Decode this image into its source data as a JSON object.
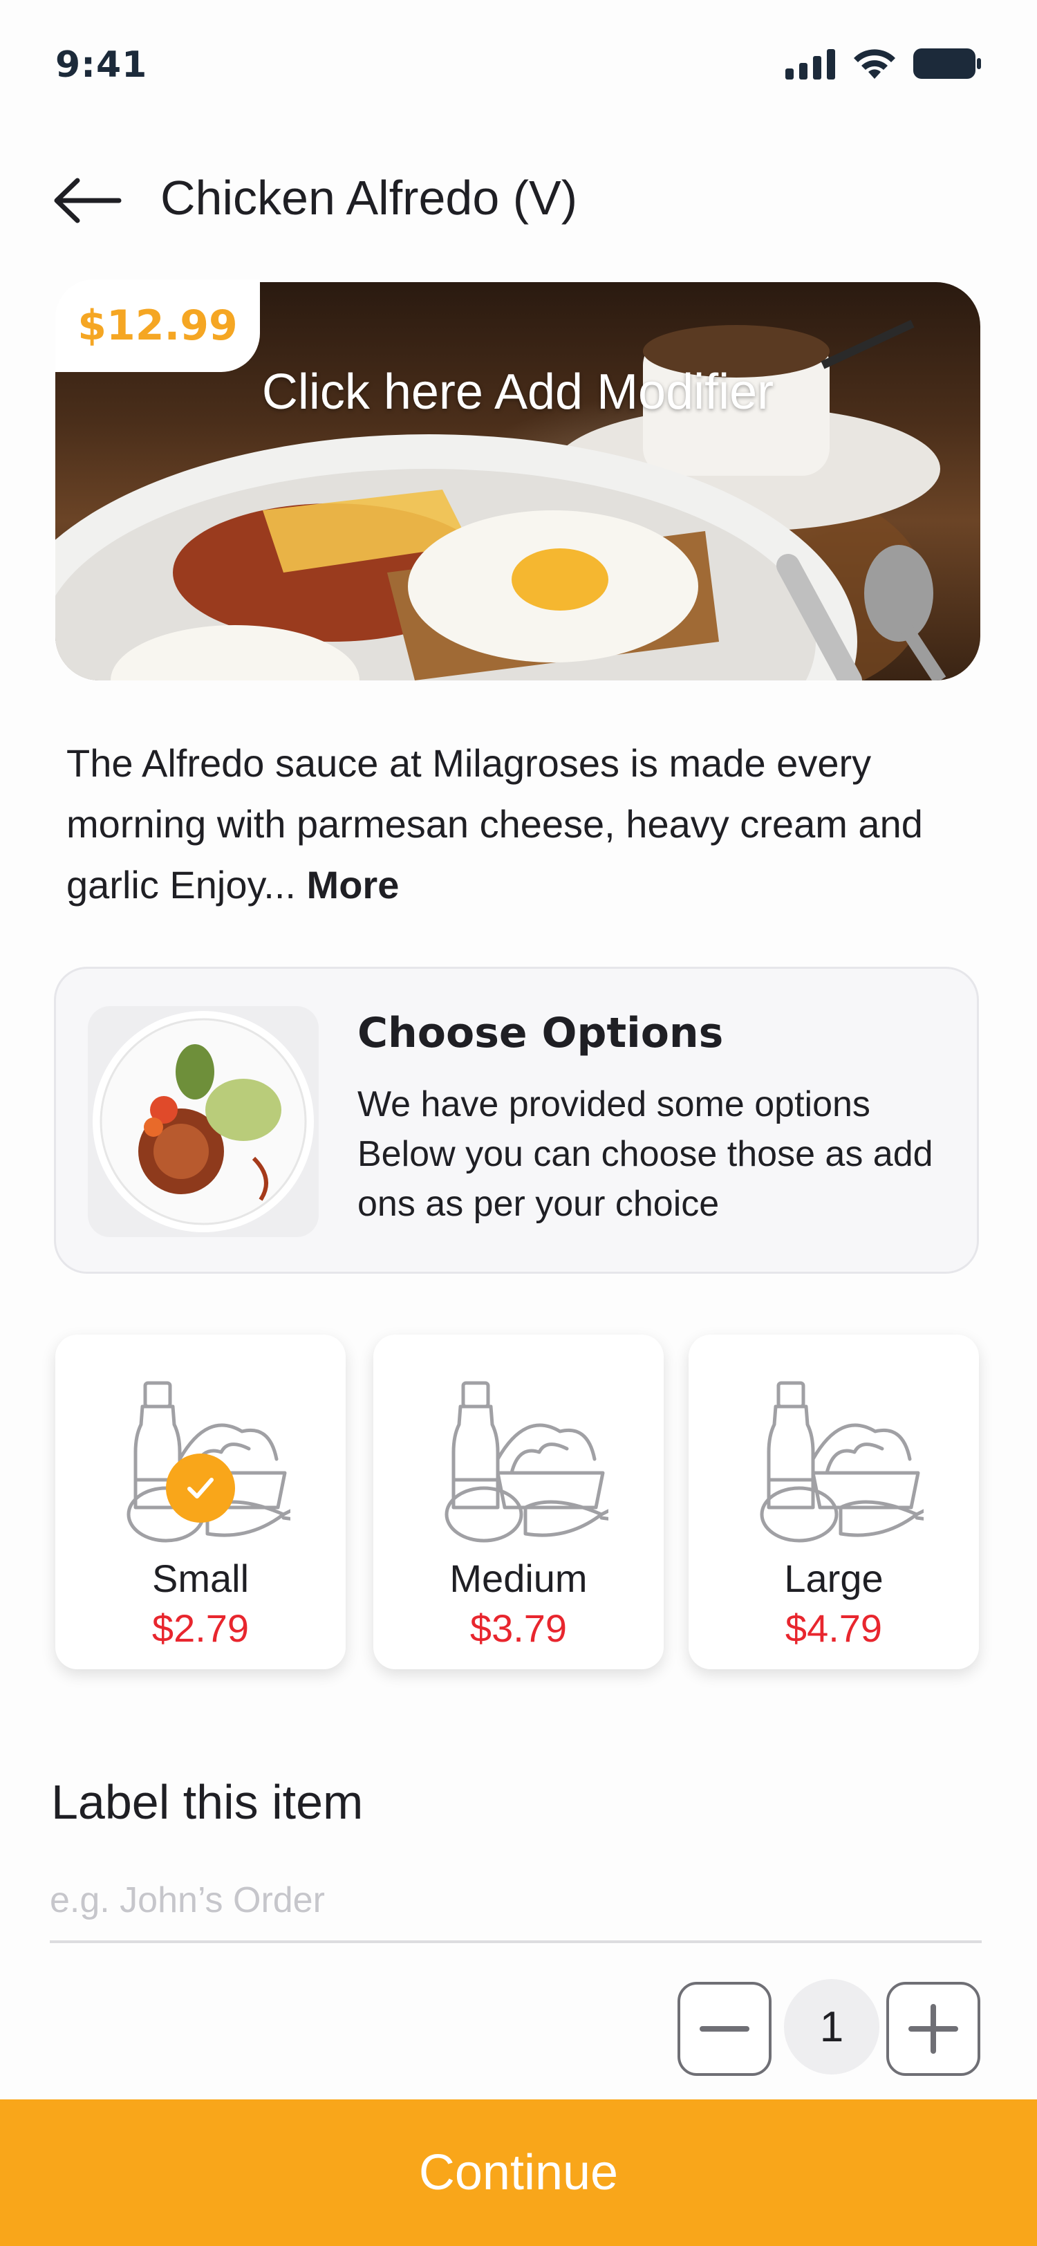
{
  "status_bar": {
    "time": "9:41"
  },
  "header": {
    "title": "Chicken Alfredo (V)"
  },
  "hero": {
    "price": "$12.99",
    "cta": "Click here Add Modifier"
  },
  "description": {
    "text": "The Alfredo sauce at Milagroses is made every morning with parmesan cheese, heavy cream and garlic Enjoy... ",
    "more_label": "More"
  },
  "options": {
    "title": "Choose Options",
    "text": "We have provided some options Below you can choose those as add ons as per your choice"
  },
  "sizes": [
    {
      "name": "Small",
      "price": "$2.79",
      "selected": true
    },
    {
      "name": "Medium",
      "price": "$3.79",
      "selected": false
    },
    {
      "name": "Large",
      "price": "$4.79",
      "selected": false
    }
  ],
  "label_section": {
    "title": "Label this item",
    "placeholder": "e.g. John’s Order",
    "value": ""
  },
  "quantity": {
    "value": "1"
  },
  "continue_label": "Continue",
  "colors": {
    "accent": "#f9a61a",
    "price_red": "#e8262e",
    "price_tag": "#f5a623"
  }
}
